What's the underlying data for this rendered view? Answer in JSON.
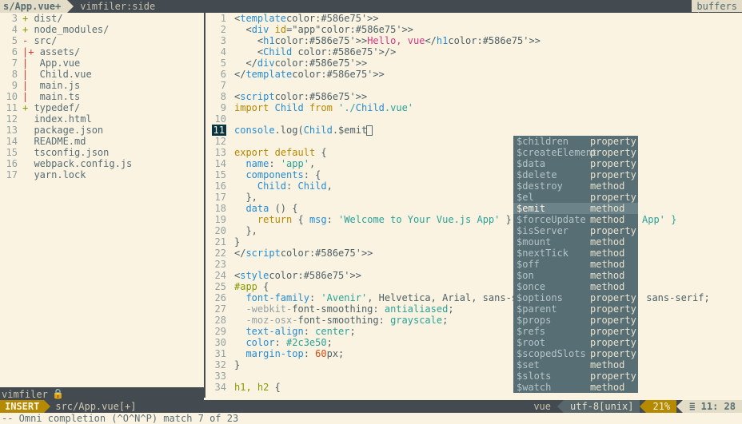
{
  "tabs": {
    "active": "s/App.vue+",
    "other": "vimfiler:side",
    "buffers": "buffers"
  },
  "filer": {
    "lines": [
      {
        "n": 3,
        "mark": "+",
        "cls": "plus-grn",
        "text": "dist/"
      },
      {
        "n": 4,
        "mark": "+",
        "cls": "plus-grn",
        "text": "node_modules/"
      },
      {
        "n": 5,
        "mark": "-",
        "cls": "minus-red",
        "text": "src/"
      },
      {
        "n": 6,
        "mark": "|+",
        "cls": "pipe-red",
        "text": "assets/"
      },
      {
        "n": 7,
        "mark": "|",
        "cls": "pipe-red",
        "text": " App.vue"
      },
      {
        "n": 8,
        "mark": "|",
        "cls": "pipe-red",
        "text": " Child.vue"
      },
      {
        "n": 9,
        "mark": "|",
        "cls": "pipe-red",
        "text": " main.js"
      },
      {
        "n": 10,
        "mark": "|",
        "cls": "pipe-red",
        "text": " main.ts"
      },
      {
        "n": 11,
        "mark": "+",
        "cls": "plus-grn",
        "text": "typedef/"
      },
      {
        "n": 12,
        "mark": "",
        "cls": "",
        "text": " index.html"
      },
      {
        "n": 13,
        "mark": "",
        "cls": "",
        "text": " package.json"
      },
      {
        "n": 14,
        "mark": "",
        "cls": "",
        "text": " README.md"
      },
      {
        "n": 15,
        "mark": "",
        "cls": "",
        "text": " tsconfig.json"
      },
      {
        "n": 16,
        "mark": "",
        "cls": "",
        "text": " webpack.config.js"
      },
      {
        "n": 17,
        "mark": "",
        "cls": "",
        "text": " yarn.lock"
      }
    ],
    "status": "vimfiler",
    "lock": "🔒"
  },
  "editor": {
    "lines": [
      "<template>",
      "  <div id=\"app\">",
      "    <h1>Hello, vue</h1>",
      "    <Child />",
      "  </div>",
      "</template>",
      "",
      "<script>",
      "import Child from './Child.vue'",
      "",
      "console.log(Child.$emit)",
      "",
      "export default {",
      "  name: 'app',",
      "  components: {",
      "    Child: Child,",
      "  },",
      "  data () {",
      "    return { msg: 'Welcome to Your Vue.js App' }",
      "  },",
      "}",
      "</script>",
      "",
      "<style>",
      "#app {",
      "  font-family: 'Avenir', Helvetica, Arial, sans-serif;",
      "  -webkit-font-smoothing: antialiased;",
      "  -moz-osx-font-smoothing: grayscale;",
      "  text-align: center;",
      "  color: #2c3e50;",
      "  margin-top: 60px;",
      "}",
      "",
      "h1, h2 {"
    ],
    "cursor_line": 11,
    "frag_appTail": "App' }",
    "frag_sansSerif": " sans-serif;"
  },
  "completion": {
    "selected_index": 6,
    "items": [
      {
        "label": "$children",
        "kind": "property"
      },
      {
        "label": "$createElement",
        "kind": "property"
      },
      {
        "label": "$data",
        "kind": "property"
      },
      {
        "label": "$delete",
        "kind": "property"
      },
      {
        "label": "$destroy",
        "kind": "method"
      },
      {
        "label": "$el",
        "kind": "property"
      },
      {
        "label": "$emit",
        "kind": "method"
      },
      {
        "label": "$forceUpdate",
        "kind": "method"
      },
      {
        "label": "$isServer",
        "kind": "property"
      },
      {
        "label": "$mount",
        "kind": "method"
      },
      {
        "label": "$nextTick",
        "kind": "method"
      },
      {
        "label": "$off",
        "kind": "method"
      },
      {
        "label": "$on",
        "kind": "method"
      },
      {
        "label": "$once",
        "kind": "method"
      },
      {
        "label": "$options",
        "kind": "property"
      },
      {
        "label": "$parent",
        "kind": "property"
      },
      {
        "label": "$props",
        "kind": "property"
      },
      {
        "label": "$refs",
        "kind": "property"
      },
      {
        "label": "$root",
        "kind": "property"
      },
      {
        "label": "$scopedSlots",
        "kind": "property"
      },
      {
        "label": "$set",
        "kind": "method"
      },
      {
        "label": "$slots",
        "kind": "property"
      },
      {
        "label": "$watch",
        "kind": "method"
      }
    ]
  },
  "status": {
    "mode": "INSERT",
    "file": "src/App.vue[+]",
    "filetype": "vue",
    "encoding": "utf-8[unix]",
    "percent": "21%",
    "zigzag": "≣",
    "line": "11",
    "col": "28"
  },
  "cmdline": "-- Omni completion (^O^N^P) match 7 of 23"
}
